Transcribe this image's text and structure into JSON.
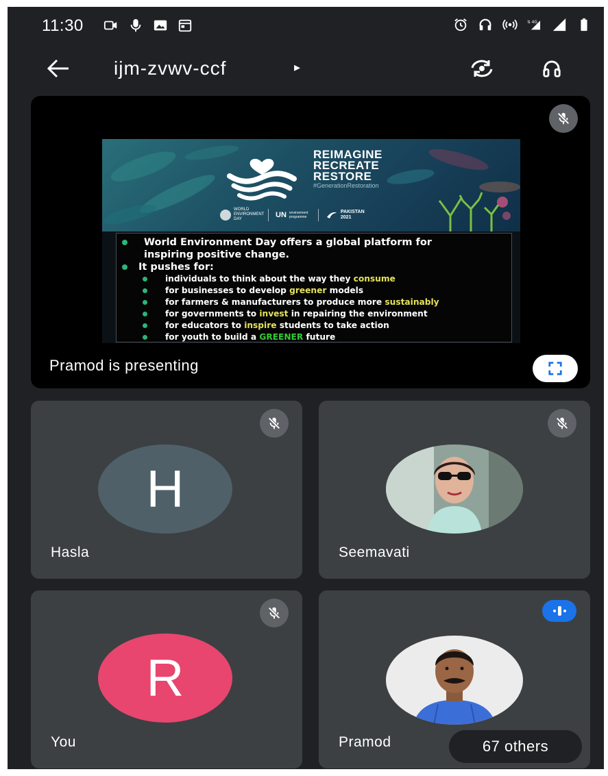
{
  "status_bar": {
    "time": "11:30",
    "left_icons": [
      "video-call-icon",
      "mic-icon",
      "image-icon",
      "calendar-icon"
    ],
    "right_icons": [
      "alarm-icon",
      "headset-icon",
      "hotspot-icon",
      "4g-signal-icon",
      "signal-icon",
      "battery-icon"
    ],
    "network": "4G"
  },
  "top_bar": {
    "meeting_code": "ijm-zvwv-ccf",
    "caret": "▸",
    "actions": [
      "switch-camera-icon",
      "headset-icon"
    ]
  },
  "presentation": {
    "label": "Pramod is presenting",
    "muted": true,
    "slide": {
      "banner": {
        "line1": "REIMAGINE",
        "line2": "RECREATE",
        "line3": "RESTORE",
        "hashtag": "#GenerationRestoration",
        "logo_1": "WORLD ENVIRONMENT DAY",
        "logo_2": "UN",
        "logo_2b": "environment programme",
        "logo_3": "PAKISTAN 2021"
      },
      "bullet_1_line1": "World Environment Day offers a global platform for",
      "bullet_1_line2": "inspiring positive change.",
      "bullet_2": "It pushes for:",
      "sub_items": [
        {
          "pre": "individuals to think about the way they ",
          "hl": "consume",
          "post": ""
        },
        {
          "pre": "for businesses to develop ",
          "hl": "greener",
          "post": " models"
        },
        {
          "pre": "for farmers & manufacturers to produce more ",
          "hl": "sustainably",
          "post": ""
        },
        {
          "pre": "for governments to ",
          "hl": "invest",
          "post": " in repairing the environment"
        },
        {
          "pre": "for educators to ",
          "hl": "inspire",
          "post": " students to take action"
        },
        {
          "pre": "for youth to build a ",
          "hl": "GREENER",
          "post": " future"
        }
      ]
    }
  },
  "participants": [
    {
      "name": "Hasla",
      "initial": "H",
      "color": "#4f6069",
      "muted": true
    },
    {
      "name": "Seemavati",
      "muted": true
    },
    {
      "name": "You",
      "initial": "R",
      "color": "#e8466f",
      "muted": true
    },
    {
      "name": "Pramod",
      "speaking": true,
      "others_label": "67 others"
    }
  ],
  "colors": {
    "background": "#202124",
    "tile": "#3c4043",
    "accent_blue": "#1a73e8",
    "highlight_yellow": "#e6e25a",
    "highlight_green": "#33cc33"
  }
}
